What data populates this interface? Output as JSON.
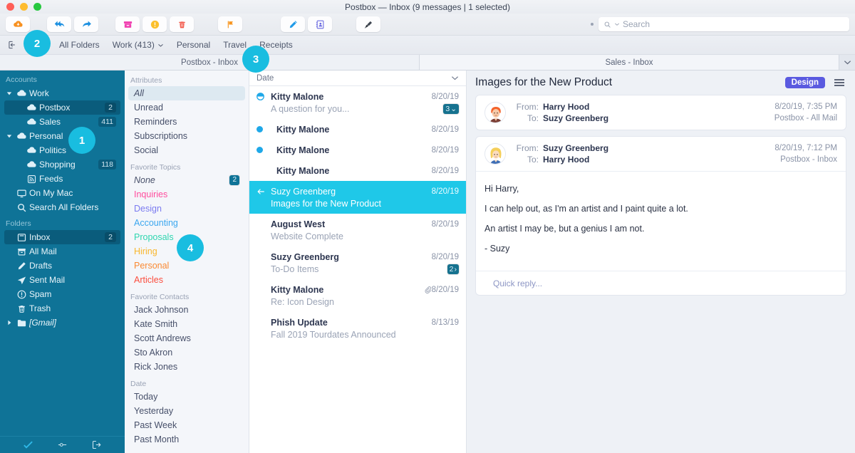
{
  "window": {
    "title": "Postbox — Inbox (9 messages | 1 selected)"
  },
  "toolbar": {
    "buttons": [
      {
        "name": "get-mail-icon",
        "label": "Get Mail"
      },
      {
        "name": "reply-all-icon",
        "label": "Reply All"
      },
      {
        "name": "forward-icon",
        "label": "Forward"
      },
      {
        "name": "archive-icon",
        "label": "Archive"
      },
      {
        "name": "junk-icon",
        "label": "Junk"
      },
      {
        "name": "delete-icon",
        "label": "Delete"
      },
      {
        "name": "flag-icon",
        "label": "Flag"
      },
      {
        "name": "compose-icon",
        "label": "Compose"
      },
      {
        "name": "address-book-icon",
        "label": "Address Book"
      },
      {
        "name": "clean-icon",
        "label": "Clean Up"
      }
    ],
    "search": {
      "placeholder": "Search",
      "value": ""
    }
  },
  "filterbar": {
    "items": [
      "All Folders",
      "Work (413)",
      "Personal",
      "Travel",
      "Receipts"
    ]
  },
  "tabs": [
    {
      "label": "Postbox - Inbox",
      "active": true
    },
    {
      "label": "Sales - Inbox",
      "active": false
    }
  ],
  "sidebar": {
    "sections": [
      {
        "header": "Accounts",
        "items": [
          {
            "label": "Work",
            "icon": "cloud-icon",
            "indent": 0,
            "twisty": "down",
            "badge": "",
            "selected": false
          },
          {
            "label": "Postbox",
            "icon": "cloud-icon",
            "indent": 1,
            "twisty": "",
            "badge": "2",
            "selected": true
          },
          {
            "label": "Sales",
            "icon": "cloud-icon",
            "indent": 1,
            "twisty": "",
            "badge": "411",
            "selected": false
          },
          {
            "label": "Personal",
            "icon": "cloud-icon",
            "indent": 0,
            "twisty": "down",
            "badge": "",
            "selected": false
          },
          {
            "label": "Politics",
            "icon": "cloud-icon",
            "indent": 1,
            "twisty": "",
            "badge": "",
            "selected": false
          },
          {
            "label": "Shopping",
            "icon": "cloud-icon",
            "indent": 1,
            "twisty": "",
            "badge": "118",
            "selected": false
          },
          {
            "label": "Feeds",
            "icon": "rss-icon",
            "indent": 1,
            "twisty": "",
            "badge": "",
            "selected": false
          },
          {
            "label": "On My Mac",
            "icon": "monitor-icon",
            "indent": 0,
            "twisty": "",
            "badge": "",
            "selected": false
          },
          {
            "label": "Search All Folders",
            "icon": "search-icon",
            "indent": 0,
            "twisty": "",
            "badge": "",
            "selected": false
          }
        ]
      },
      {
        "header": "Folders",
        "items": [
          {
            "label": "Inbox",
            "icon": "inbox-icon",
            "indent": 0,
            "twisty": "",
            "badge": "2",
            "selected": true
          },
          {
            "label": "All Mail",
            "icon": "allmail-icon",
            "indent": 0,
            "twisty": "",
            "badge": "",
            "selected": false
          },
          {
            "label": "Drafts",
            "icon": "pencil-icon",
            "indent": 0,
            "twisty": "",
            "badge": "",
            "selected": false
          },
          {
            "label": "Sent Mail",
            "icon": "send-icon",
            "indent": 0,
            "twisty": "",
            "badge": "",
            "selected": false
          },
          {
            "label": "Spam",
            "icon": "spam-icon",
            "indent": 0,
            "twisty": "",
            "badge": "",
            "selected": false
          },
          {
            "label": "Trash",
            "icon": "trash-icon",
            "indent": 0,
            "twisty": "",
            "badge": "",
            "selected": false
          },
          {
            "label": "[Gmail]",
            "icon": "folder-icon",
            "indent": 0,
            "twisty": "right",
            "badge": "",
            "selected": false,
            "italic": true
          }
        ]
      }
    ]
  },
  "filters": {
    "sections": [
      {
        "header": "Attributes",
        "items": [
          {
            "label": "All",
            "selected": true,
            "italic": true,
            "color": "#47506a",
            "badge": ""
          },
          {
            "label": "Unread",
            "selected": false,
            "italic": false,
            "color": "#47506a",
            "badge": ""
          },
          {
            "label": "Reminders",
            "selected": false,
            "italic": false,
            "color": "#47506a",
            "badge": ""
          },
          {
            "label": "Subscriptions",
            "selected": false,
            "italic": false,
            "color": "#47506a",
            "badge": ""
          },
          {
            "label": "Social",
            "selected": false,
            "italic": false,
            "color": "#47506a",
            "badge": ""
          }
        ]
      },
      {
        "header": "Favorite Topics",
        "items": [
          {
            "label": "None",
            "selected": false,
            "italic": true,
            "color": "#47506a",
            "badge": "2"
          },
          {
            "label": "Inquiries",
            "selected": false,
            "italic": false,
            "color": "#ff4d9d",
            "badge": ""
          },
          {
            "label": "Design",
            "selected": false,
            "italic": false,
            "color": "#7b7bf0",
            "badge": ""
          },
          {
            "label": "Accounting",
            "selected": false,
            "italic": false,
            "color": "#3ba7ef",
            "badge": ""
          },
          {
            "label": "Proposals",
            "selected": false,
            "italic": false,
            "color": "#2fd6b0",
            "badge": ""
          },
          {
            "label": "Hiring",
            "selected": false,
            "italic": false,
            "color": "#f8b62c",
            "badge": ""
          },
          {
            "label": "Personal",
            "selected": false,
            "italic": false,
            "color": "#fa8a33",
            "badge": ""
          },
          {
            "label": "Articles",
            "selected": false,
            "italic": false,
            "color": "#fb4d3d",
            "badge": ""
          }
        ]
      },
      {
        "header": "Favorite Contacts",
        "items": [
          {
            "label": "Jack Johnson",
            "selected": false,
            "italic": false,
            "color": "#47506a",
            "badge": ""
          },
          {
            "label": "Kate Smith",
            "selected": false,
            "italic": false,
            "color": "#47506a",
            "badge": ""
          },
          {
            "label": "Scott Andrews",
            "selected": false,
            "italic": false,
            "color": "#47506a",
            "badge": ""
          },
          {
            "label": "Sto Akron",
            "selected": false,
            "italic": false,
            "color": "#47506a",
            "badge": ""
          },
          {
            "label": "Rick Jones",
            "selected": false,
            "italic": false,
            "color": "#47506a",
            "badge": ""
          }
        ]
      },
      {
        "header": "Date",
        "items": [
          {
            "label": "Today",
            "selected": false,
            "italic": false,
            "color": "#47506a",
            "badge": ""
          },
          {
            "label": "Yesterday",
            "selected": false,
            "italic": false,
            "color": "#47506a",
            "badge": ""
          },
          {
            "label": "Past Week",
            "selected": false,
            "italic": false,
            "color": "#47506a",
            "badge": ""
          },
          {
            "label": "Past Month",
            "selected": false,
            "italic": false,
            "color": "#47506a",
            "badge": ""
          }
        ]
      }
    ]
  },
  "messagelist": {
    "sort_header": "Date",
    "rows": [
      {
        "from": "Kitty Malone",
        "subject": "A question for you...",
        "date": "8/20/19",
        "status": "thread",
        "count": "3",
        "count_caret": "⌄",
        "indent": false,
        "attachment": false,
        "selected": false
      },
      {
        "from": "Kitty Malone",
        "subject": "",
        "date": "8/20/19",
        "status": "unread",
        "count": "",
        "count_caret": "",
        "indent": true,
        "attachment": false,
        "selected": false
      },
      {
        "from": "Kitty Malone",
        "subject": "",
        "date": "8/20/19",
        "status": "unread",
        "count": "",
        "count_caret": "",
        "indent": true,
        "attachment": false,
        "selected": false
      },
      {
        "from": "Kitty Malone",
        "subject": "",
        "date": "8/20/19",
        "status": "read",
        "count": "",
        "count_caret": "",
        "indent": true,
        "attachment": false,
        "selected": false
      },
      {
        "from": "Suzy Greenberg",
        "subject": "Images for the New Product",
        "date": "8/20/19",
        "status": "replied",
        "count": "",
        "count_caret": "",
        "indent": false,
        "attachment": false,
        "selected": true
      },
      {
        "from": "August West",
        "subject": "Website Complete",
        "date": "8/20/19",
        "status": "read",
        "count": "",
        "count_caret": "",
        "indent": false,
        "attachment": false,
        "selected": false
      },
      {
        "from": "Suzy Greenberg",
        "subject": "To-Do Items",
        "date": "8/20/19",
        "status": "read",
        "count": "2",
        "count_caret": "›",
        "indent": false,
        "attachment": false,
        "selected": false
      },
      {
        "from": "Kitty Malone",
        "subject": "Re: Icon Design",
        "date": "8/20/19",
        "status": "read",
        "count": "",
        "count_caret": "",
        "indent": false,
        "attachment": true,
        "selected": false
      },
      {
        "from": "Phish Update",
        "subject": "Fall 2019 Tourdates Announced",
        "date": "8/13/19",
        "status": "read",
        "count": "",
        "count_caret": "",
        "indent": false,
        "attachment": false,
        "selected": false
      }
    ]
  },
  "reading": {
    "title": "Images for the New Product",
    "tag": "Design",
    "messages": [
      {
        "avatar": "male-avatar",
        "from_label": "From:",
        "from": "Harry Hood",
        "to_label": "To:",
        "to": "Suzy Greenberg",
        "timestamp": "8/20/19, 7:35 PM",
        "folder": "Postbox - All Mail",
        "collapsed": true,
        "body": []
      },
      {
        "avatar": "female-avatar",
        "from_label": "From:",
        "from": "Suzy Greenberg",
        "to_label": "To:",
        "to": "Harry Hood",
        "timestamp": "8/20/19, 7:12 PM",
        "folder": "Postbox - Inbox",
        "collapsed": false,
        "body": [
          "Hi Harry,",
          "I can help out, as I'm an artist and I paint quite a lot.",
          "An artist I may be, but a genius I am not.",
          "- Suzy"
        ],
        "quick_reply": "Quick reply..."
      }
    ]
  },
  "callouts": [
    {
      "number": "1"
    },
    {
      "number": "2"
    },
    {
      "number": "3"
    },
    {
      "number": "4"
    }
  ],
  "colors": {
    "sidebar_bg": "#0f7397",
    "selection": "#1fc8e8",
    "accent_tag": "#5a5ae0",
    "callout": "#19bde0"
  }
}
